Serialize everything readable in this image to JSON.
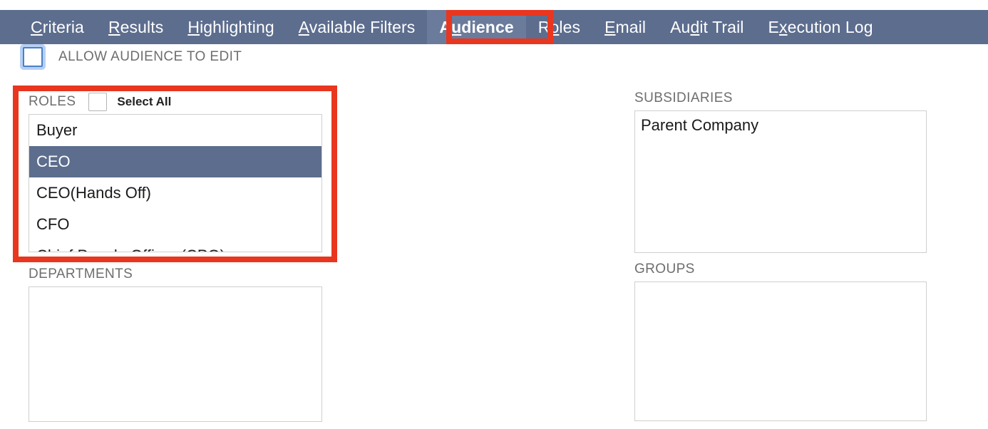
{
  "tabs": [
    {
      "pre": "",
      "key": "C",
      "post": "riteria",
      "active": false
    },
    {
      "pre": "",
      "key": "R",
      "post": "esults",
      "active": false
    },
    {
      "pre": "",
      "key": "H",
      "post": "ighlighting",
      "active": false
    },
    {
      "pre": "",
      "key": "A",
      "post": "vailable Filters",
      "active": false
    },
    {
      "pre": "A",
      "key": "u",
      "post": "dience",
      "active": true
    },
    {
      "pre": "R",
      "key": "o",
      "post": "les",
      "active": false
    },
    {
      "pre": "",
      "key": "E",
      "post": "mail",
      "active": false
    },
    {
      "pre": "Au",
      "key": "d",
      "post": "it Trail",
      "active": false
    },
    {
      "pre": "E",
      "key": "x",
      "post": "ecution Log",
      "active": false
    }
  ],
  "allow_audience": {
    "label": "ALLOW AUDIENCE TO EDIT",
    "checked": false
  },
  "roles": {
    "label": "ROLES",
    "select_all_label": "Select All",
    "select_all_checked": false,
    "items": [
      {
        "text": "Buyer",
        "selected": false
      },
      {
        "text": "CEO",
        "selected": true
      },
      {
        "text": "CEO(Hands Off)",
        "selected": false
      },
      {
        "text": "CFO",
        "selected": false
      },
      {
        "text": "Chief People Officer (CPO)",
        "selected": false
      }
    ]
  },
  "subsidiaries": {
    "label": "SUBSIDIARIES",
    "items": [
      {
        "text": "Parent Company",
        "selected": false
      }
    ]
  },
  "departments": {
    "label": "DEPARTMENTS",
    "items": []
  },
  "groups": {
    "label": "GROUPS",
    "items": []
  },
  "annotations": {
    "color": "#e8361f",
    "targets": [
      "audience-tab",
      "roles-field"
    ]
  },
  "colors": {
    "tabbar": "#5d6d8e",
    "tab_active_bg": "#6b7b9b",
    "selection": "#5d6d8e",
    "annotation": "#e8361f",
    "label_text": "#6e6e6e",
    "focus_ring": "#4a80c7"
  }
}
